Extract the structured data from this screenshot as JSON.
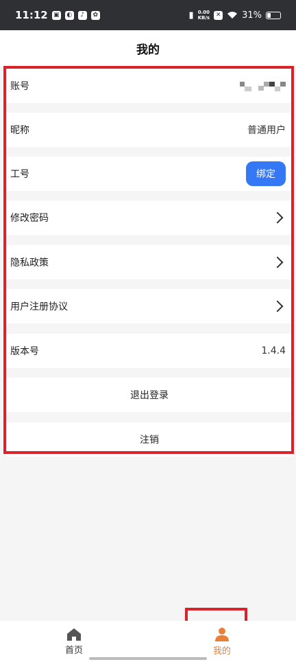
{
  "status_bar": {
    "time": "11:12",
    "net_speed_value": "0.00",
    "net_speed_unit": "KB/s",
    "battery": "31%",
    "battery_level": 0.31
  },
  "header": {
    "title": "我的"
  },
  "rows": {
    "account": {
      "label": "账号",
      "value": ""
    },
    "nickname": {
      "label": "昵称",
      "value": "普通用户"
    },
    "employee_id": {
      "label": "工号",
      "button_label": "绑定"
    },
    "change_password": {
      "label": "修改密码"
    },
    "privacy_policy": {
      "label": "隐私政策"
    },
    "user_agreement": {
      "label": "用户注册协议"
    },
    "version": {
      "label": "版本号",
      "value": "1.4.4"
    },
    "logout": {
      "label": "退出登录"
    },
    "deregister": {
      "label": "注销"
    }
  },
  "tabs": [
    {
      "label": "首页",
      "icon": "home-icon",
      "active": false
    },
    {
      "label": "我的",
      "icon": "user-icon",
      "active": true
    }
  ],
  "colors": {
    "accent_blue": "#3478f6",
    "active_tab": "#e8803a",
    "inactive_tab": "#333333",
    "highlight_box": "#d8232a"
  }
}
